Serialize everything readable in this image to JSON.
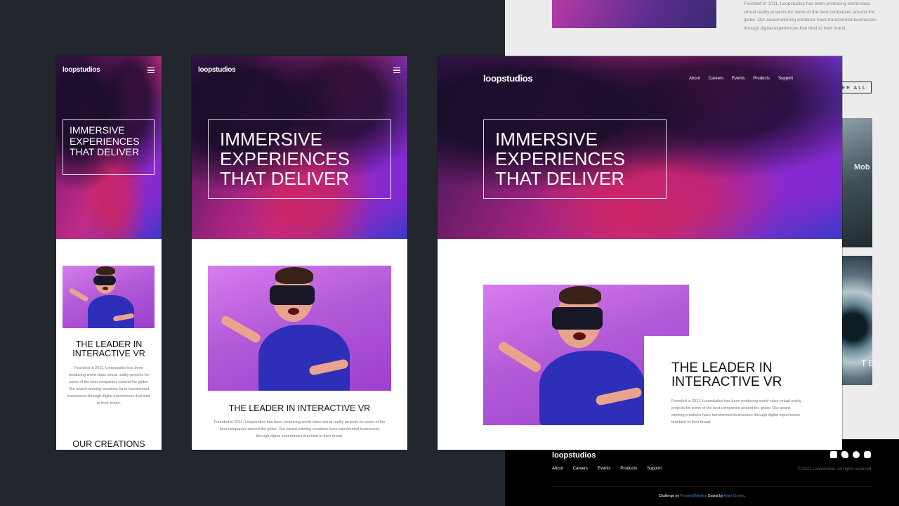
{
  "brand": {
    "logo": "loopstudios"
  },
  "hero": {
    "headline": "IMMERSIVE EXPERIENCES THAT DELIVER"
  },
  "nav": {
    "items": [
      "About",
      "Careers",
      "Events",
      "Products",
      "Support"
    ]
  },
  "leader": {
    "title": "THE LEADER IN INTERACTIVE VR",
    "body": "Founded in 2011, Loopstudios has been producing world-class virtual reality projects for some of the best companies around the globe. Our award-winning creations have transformed businesses through digital experiences that bind to their brand."
  },
  "creations": {
    "title": "OUR CREATIONS",
    "see_all": "SEE ALL"
  },
  "backdrop": {
    "text": "Founded in 2011, Loopstudios has been producing world-class virtual reality projects for some of the best companies around the globe. Our award-winning creations have transformed businesses through digital experiences that bind to their brand.",
    "card1_text": "Mob",
    "card2_text": "T E"
  },
  "footer": {
    "logo": "loopstudios",
    "nav": [
      "About",
      "Careers",
      "Events",
      "Products",
      "Support"
    ],
    "copyright": "© 2021 Loopstudios. All rights reserved.",
    "credit_prefix": "Challenge by",
    "credit_fm": "Frontend Mentor",
    "credit_mid": ". Coded by",
    "credit_author": "Argel Orones",
    "credit_end": "."
  },
  "icons": [
    "menu-icon",
    "facebook-icon",
    "twitter-icon",
    "pinterest-icon",
    "instagram-icon"
  ]
}
